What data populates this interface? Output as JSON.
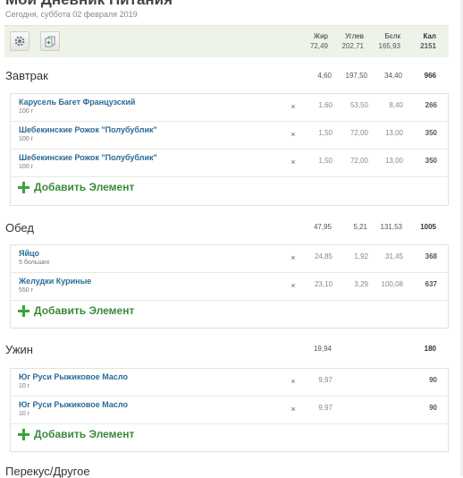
{
  "header": {
    "title": "Мой Дневник Питания",
    "date": "Сегодня, суббота 02 февраля 2019"
  },
  "totals": {
    "headers": {
      "fat": "Жир",
      "carb": "Углев",
      "prot": "Бєлк",
      "kal": "Кал"
    },
    "values": {
      "fat": "72,49",
      "carb": "202,71",
      "prot": "165,93",
      "kal": "2151"
    }
  },
  "icons": {
    "settings": "gear-icon",
    "copy": "copy-add-icon",
    "add": "plus-icon",
    "delete": "close-icon"
  },
  "colors": {
    "accent": "#3ba33b",
    "link": "#2c6b95",
    "bar": "#eef3ea"
  },
  "meals": [
    {
      "title": "Завтрак",
      "sum": {
        "fat": "4,60",
        "carb": "197,50",
        "prot": "34,40",
        "kal": "966"
      },
      "items": [
        {
          "name": "Карусель Багет Французский",
          "amount": "100 г",
          "x": "×",
          "fat": "1,60",
          "carb": "53,50",
          "prot": "8,40",
          "kal": "266"
        },
        {
          "name": "Шебекинские Рожок \"Полубублик\"",
          "amount": "100 г",
          "x": "×",
          "fat": "1,50",
          "carb": "72,00",
          "prot": "13,00",
          "kal": "350"
        },
        {
          "name": "Шебекинские Рожок \"Полубублик\"",
          "amount": "100 г",
          "x": "×",
          "fat": "1,50",
          "carb": "72,00",
          "prot": "13,00",
          "kal": "350"
        }
      ],
      "add_label": "Добавить Элемент"
    },
    {
      "title": "Обед",
      "sum": {
        "fat": "47,95",
        "carb": "5,21",
        "prot": "131,53",
        "kal": "1005"
      },
      "items": [
        {
          "name": "Яйцо",
          "amount": "5 больших",
          "x": "×",
          "fat": "24,85",
          "carb": "1,92",
          "prot": "31,45",
          "kal": "368"
        },
        {
          "name": "Желудки Куриные",
          "amount": "550 г",
          "x": "×",
          "fat": "23,10",
          "carb": "3,29",
          "prot": "100,08",
          "kal": "637"
        }
      ],
      "add_label": "Добавить Элемент"
    },
    {
      "title": "Ужин",
      "sum": {
        "fat": "19,94",
        "carb": "",
        "prot": "",
        "kal": "180"
      },
      "items": [
        {
          "name": "Юг Руси Рыжиковое Масло",
          "amount": "10 г",
          "x": "×",
          "fat": "9,97",
          "carb": "",
          "prot": "",
          "kal": "90"
        },
        {
          "name": "Юг Руси Рыжиковое Масло",
          "amount": "10 г",
          "x": "×",
          "fat": "9,97",
          "carb": "",
          "prot": "",
          "kal": "90"
        }
      ],
      "add_label": "Добавить Элемент"
    }
  ],
  "next_section": {
    "title": "Перекус/Другое"
  }
}
